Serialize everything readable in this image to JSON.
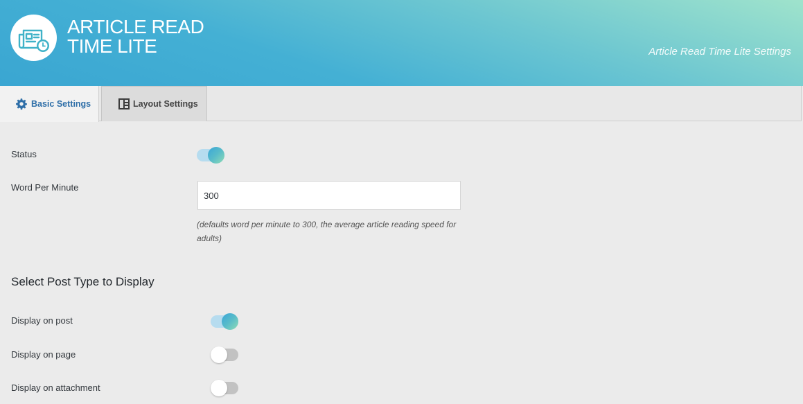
{
  "header": {
    "brand_line1": "ARTICLE READ",
    "brand_line2": "TIME LITE",
    "subtitle": "Article Read Time Lite Settings",
    "logo_icon": "newspaper-clock-icon"
  },
  "tabs": [
    {
      "label": "Basic Settings",
      "icon": "gear-icon",
      "active": true
    },
    {
      "label": "Layout Settings",
      "icon": "layout-icon",
      "active": false
    }
  ],
  "settings": {
    "status": {
      "label": "Status",
      "enabled": true
    },
    "wpm": {
      "label": "Word Per Minute",
      "value": "300",
      "hint": "(defaults word per minute to 300, the average article reading speed for adults)"
    },
    "post_types_heading": "Select Post Type to Display",
    "post_types": [
      {
        "label": "Display on post",
        "enabled": true
      },
      {
        "label": "Display on page",
        "enabled": false
      },
      {
        "label": "Display on attachment",
        "enabled": false
      }
    ]
  },
  "colors": {
    "accent": "#2f6fa8",
    "toggle_on": "#3aa6d8",
    "toggle_off": "#c2c2c2"
  }
}
